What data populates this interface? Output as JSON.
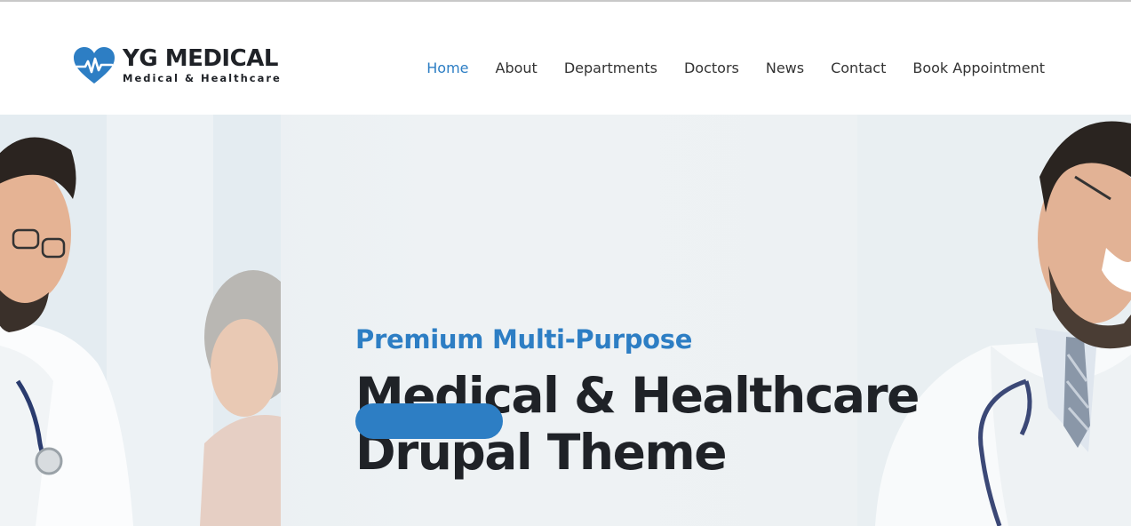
{
  "header": {
    "logo": {
      "icon": "heart-pulse-icon",
      "title": "YG MEDICAL",
      "subtitle": "Medical & Healthcare"
    },
    "nav": [
      {
        "label": "Home",
        "active": true
      },
      {
        "label": "About",
        "active": false
      },
      {
        "label": "Departments",
        "active": false
      },
      {
        "label": "Doctors",
        "active": false
      },
      {
        "label": "News",
        "active": false
      },
      {
        "label": "Contact",
        "active": false
      },
      {
        "label": "Book Appointment",
        "active": false
      }
    ]
  },
  "hero": {
    "kicker": "Premium Multi-Purpose",
    "title_line1": "Medical & Healthcare",
    "title_line2": "Drupal Theme"
  },
  "colors": {
    "accent": "#2d7ec4",
    "text_dark": "#1f2227"
  }
}
